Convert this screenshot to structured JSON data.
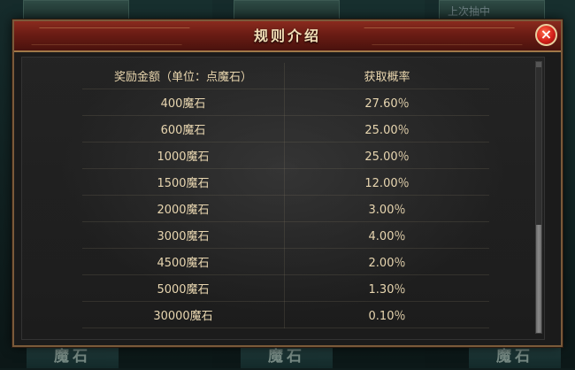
{
  "background": {
    "hint_text": "上次抽中",
    "bottom_tiles": [
      "魔石",
      "魔石",
      "魔石"
    ]
  },
  "modal": {
    "title": "规则介绍",
    "close_icon": "×",
    "table": {
      "headers": [
        "奖励金额（单位：点魔石）",
        "获取概率"
      ],
      "rows": [
        {
          "amount": "400魔石",
          "probability": "27.60％"
        },
        {
          "amount": "600魔石",
          "probability": "25.00％"
        },
        {
          "amount": "1000魔石",
          "probability": "25.00％"
        },
        {
          "amount": "1500魔石",
          "probability": "12.00％"
        },
        {
          "amount": "2000魔石",
          "probability": "3.00％"
        },
        {
          "amount": "3000魔石",
          "probability": "4.00％"
        },
        {
          "amount": "4500魔石",
          "probability": "2.00％"
        },
        {
          "amount": "5000魔石",
          "probability": "1.30％"
        },
        {
          "amount": "30000魔石",
          "probability": "0.10％"
        }
      ]
    }
  },
  "colors": {
    "title_bar": "#6a1c14",
    "text_gold": "#e8d6b0",
    "close_button": "#d4201a"
  }
}
